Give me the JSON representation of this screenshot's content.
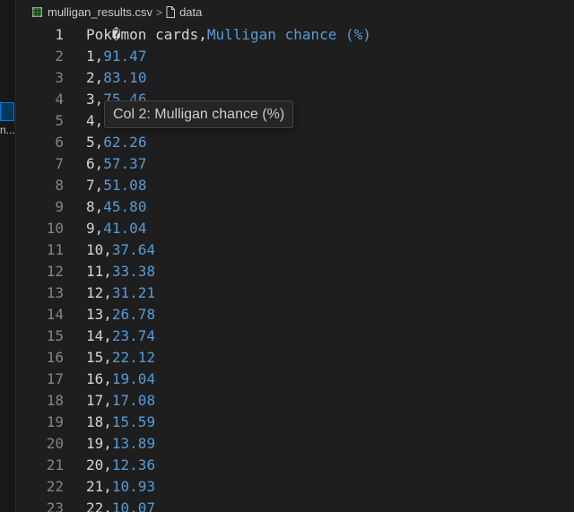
{
  "breadcrumb": {
    "file_icon": "csv-file-icon",
    "file": "mulligan_results.csv",
    "separator": ">",
    "symbol_icon": "document-icon",
    "symbol": "data"
  },
  "sidebar": {
    "truncated_label": "n..."
  },
  "editor": {
    "lines": [
      {
        "num": "1",
        "col1": "Pok�mon cards",
        "col2": "Mulligan chance (%)"
      },
      {
        "num": "2",
        "col1": "1",
        "col2": "91.47"
      },
      {
        "num": "3",
        "col1": "2",
        "col2": "83.10"
      },
      {
        "num": "4",
        "col1": "3",
        "col2": "75.46"
      },
      {
        "num": "5",
        "col1": "4",
        "col2": ""
      },
      {
        "num": "6",
        "col1": "5",
        "col2": "62.26"
      },
      {
        "num": "7",
        "col1": "6",
        "col2": "57.37"
      },
      {
        "num": "8",
        "col1": "7",
        "col2": "51.08"
      },
      {
        "num": "9",
        "col1": "8",
        "col2": "45.80"
      },
      {
        "num": "10",
        "col1": "9",
        "col2": "41.04"
      },
      {
        "num": "11",
        "col1": "10",
        "col2": "37.64"
      },
      {
        "num": "12",
        "col1": "11",
        "col2": "33.38"
      },
      {
        "num": "13",
        "col1": "12",
        "col2": "31.21"
      },
      {
        "num": "14",
        "col1": "13",
        "col2": "26.78"
      },
      {
        "num": "15",
        "col1": "14",
        "col2": "23.74"
      },
      {
        "num": "16",
        "col1": "15",
        "col2": "22.12"
      },
      {
        "num": "17",
        "col1": "16",
        "col2": "19.04"
      },
      {
        "num": "18",
        "col1": "17",
        "col2": "17.08"
      },
      {
        "num": "19",
        "col1": "18",
        "col2": "15.59"
      },
      {
        "num": "20",
        "col1": "19",
        "col2": "13.89"
      },
      {
        "num": "21",
        "col1": "20",
        "col2": "12.36"
      },
      {
        "num": "22",
        "col1": "21",
        "col2": "10.93"
      },
      {
        "num": "23",
        "col1": "22",
        "col2": "10.07"
      }
    ],
    "separator": ","
  },
  "tooltip": {
    "text": "Col 2: Mulligan chance (%)"
  },
  "colors": {
    "background": "#1e1e1e",
    "column1": "#d4d4d4",
    "column2": "#569cd6",
    "line_number": "#858585"
  }
}
